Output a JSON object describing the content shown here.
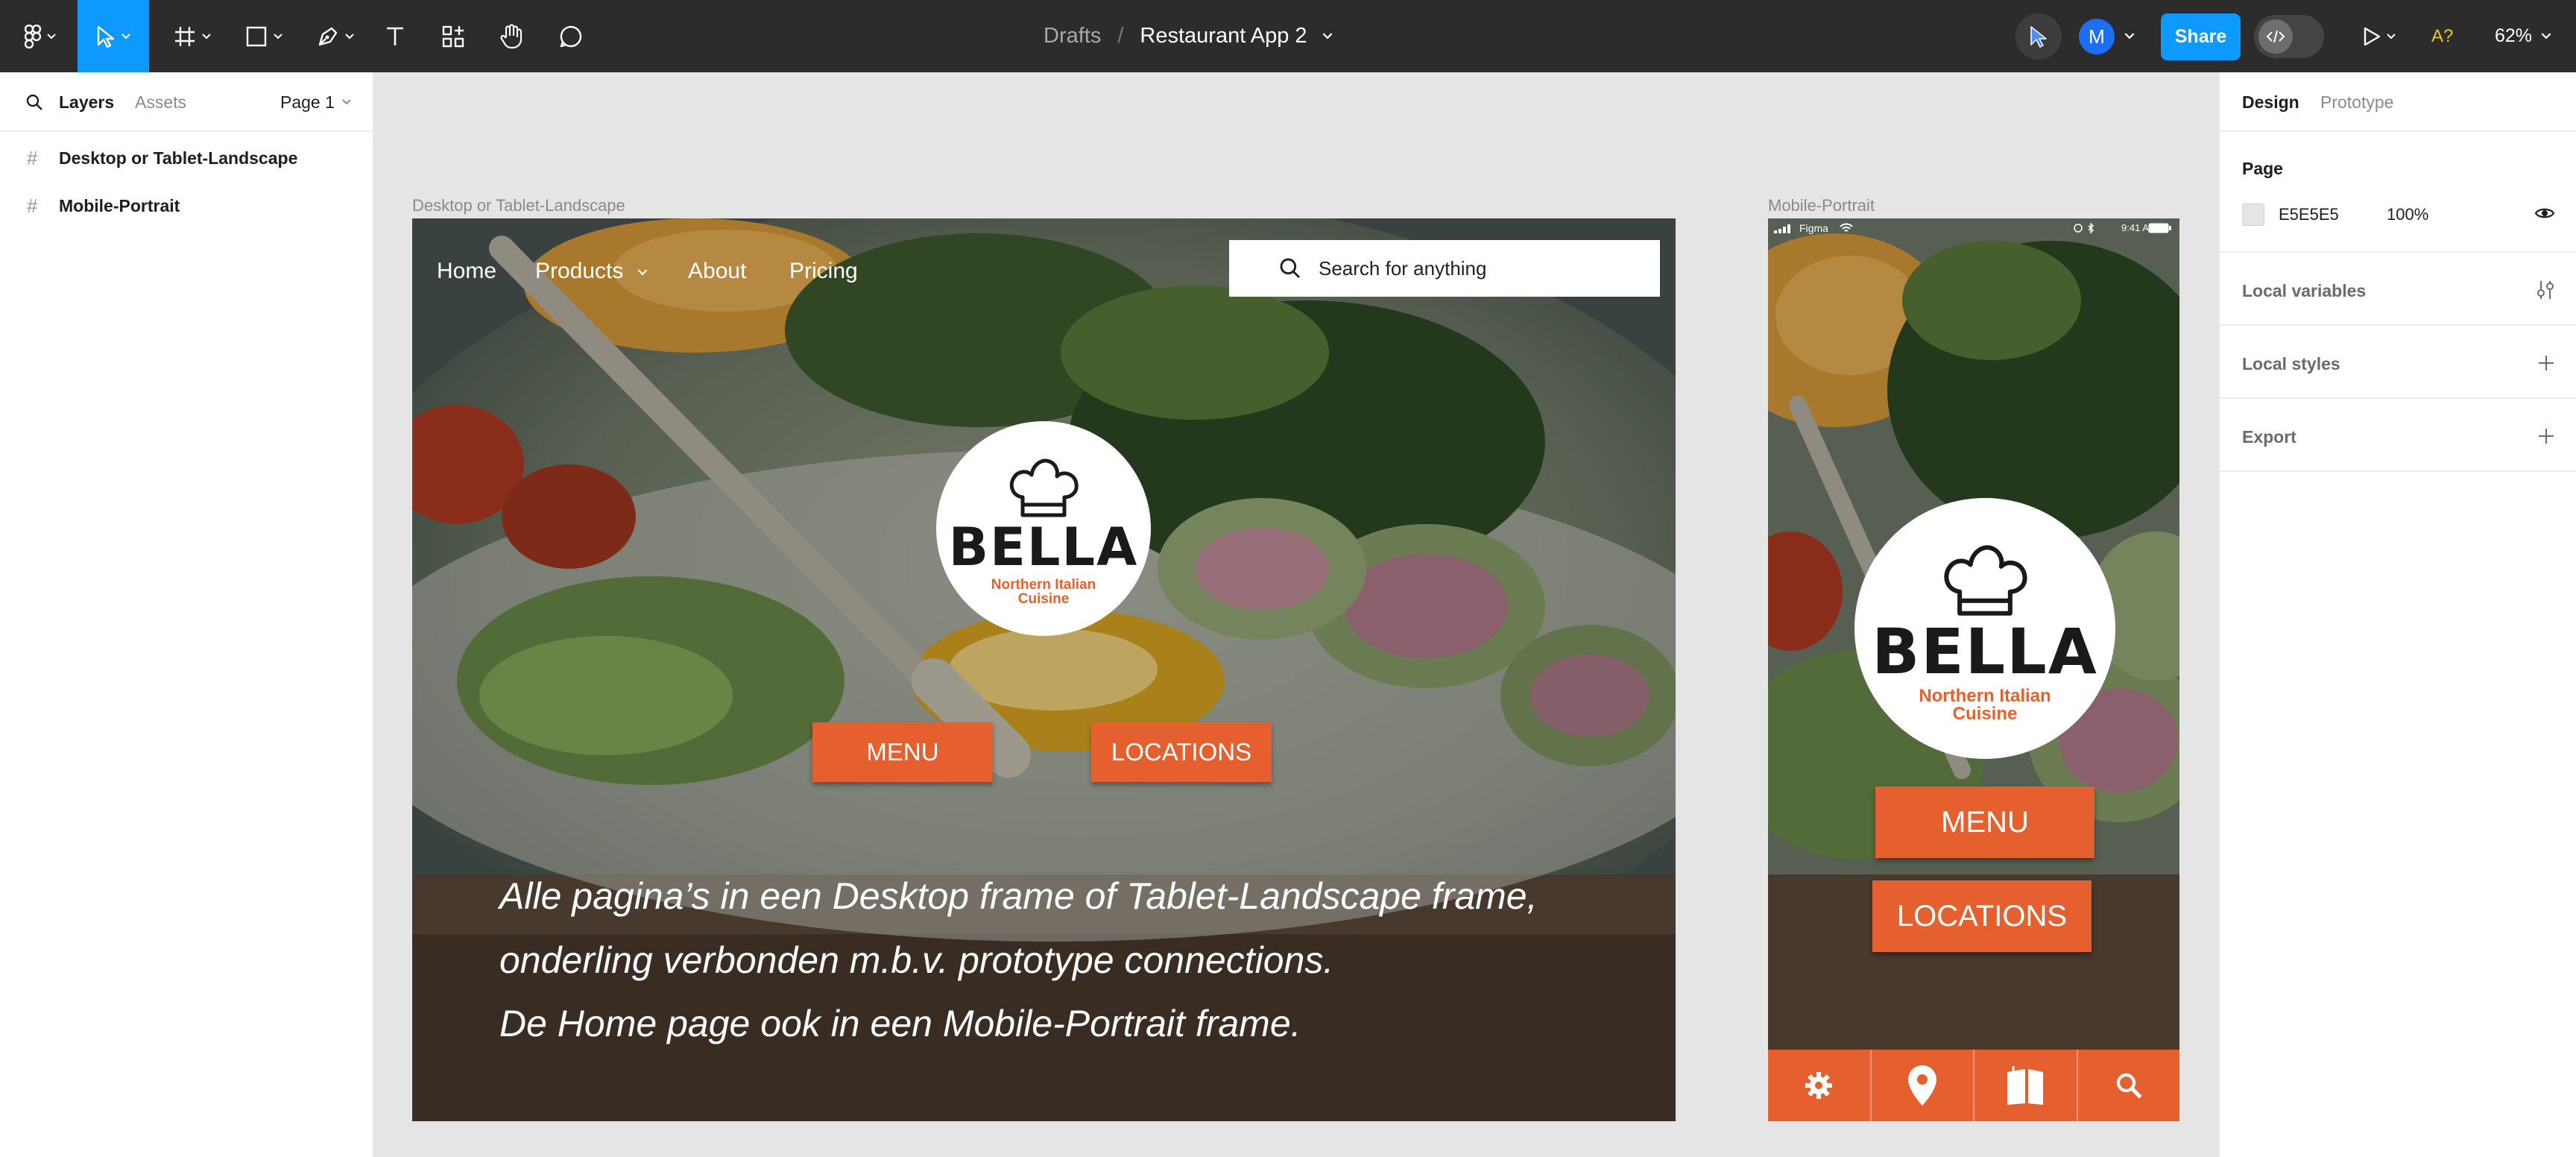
{
  "toolbar": {
    "doc_breadcrumb_parent": "Drafts",
    "doc_breadcrumb_separator": "/",
    "doc_title": "Restaurant App 2",
    "share_label": "Share",
    "avatar_initial": "M",
    "ai_label": "A?",
    "zoom": "62%",
    "icons": [
      "figma-menu-icon",
      "move-tool-icon",
      "frame-tool-icon",
      "shape-tool-icon",
      "pen-tool-icon",
      "text-tool-icon",
      "resources-icon",
      "hand-tool-icon",
      "comment-icon",
      "multiplayer-cursor-icon",
      "dev-mode-icon",
      "present-icon"
    ],
    "accent_color": "#0d99ff"
  },
  "left_panel": {
    "tabs": [
      "Layers",
      "Assets"
    ],
    "page_selector": "Page 1",
    "layers": [
      "Desktop or Tablet-Landscape",
      "Mobile-Portrait"
    ]
  },
  "canvas": {
    "background": "#e5e5e5",
    "desktop_frame": {
      "label": "Desktop or Tablet-Landscape",
      "nav": [
        "Home",
        "Products",
        "About",
        "Pricing"
      ],
      "search_placeholder": "Search for anything",
      "logo_name": "BELLA",
      "logo_sub1": "Northern Italian",
      "logo_sub2": "Cuisine",
      "btn_menu": "MENU",
      "btn_locations": "LOCATIONS",
      "text_lines": [
        "Alle pagina’s in een Desktop frame of Tablet-Landscape frame,",
        "onderling verbonden m.b.v. prototype connections.",
        "De Home page ook in een Mobile-Portrait frame."
      ]
    },
    "mobile_frame": {
      "label": "Mobile-Portrait",
      "status_carrier": "Figma",
      "status_time": "9:41 AM",
      "logo_name": "BELLA",
      "logo_sub1": "Northern Italian",
      "logo_sub2": "Cuisine",
      "btn_menu": "MENU",
      "btn_locations": "LOCATIONS",
      "bottom_icons": [
        "settings-icon",
        "location-pin-icon",
        "menu-book-icon",
        "search-icon"
      ]
    },
    "brand_orange": "#e5602e"
  },
  "right_panel": {
    "tabs": [
      "Design",
      "Prototype"
    ],
    "page_title": "Page",
    "page_color": "E5E5E5",
    "page_opacity": "100%",
    "sections": [
      "Local variables",
      "Local styles",
      "Export"
    ]
  }
}
